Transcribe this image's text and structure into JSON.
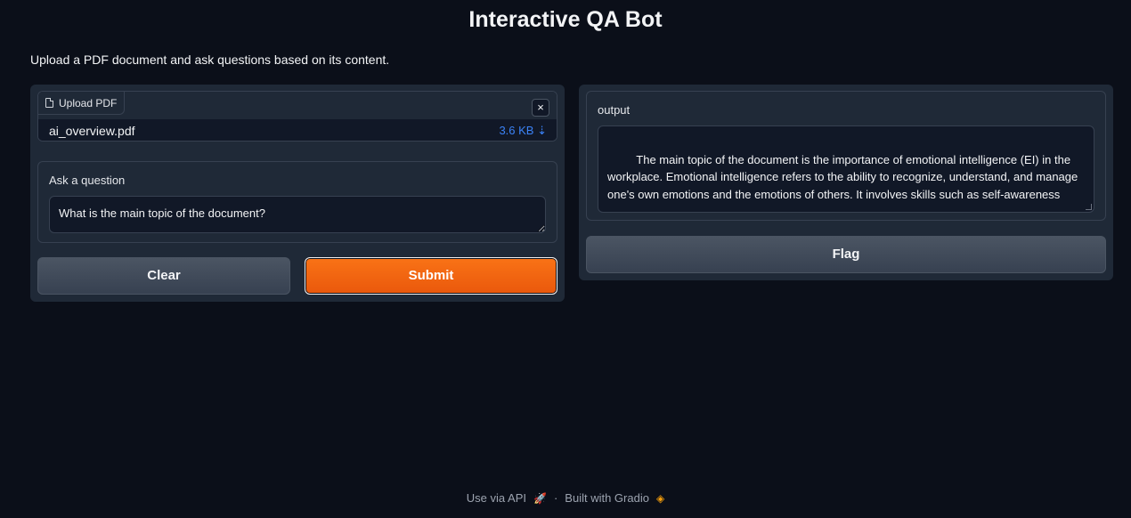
{
  "header": {
    "title": "Interactive QA Bot",
    "description": "Upload a PDF document and ask questions based on its content."
  },
  "upload": {
    "label": "Upload PDF",
    "file_name": "ai_overview.pdf",
    "file_size": "3.6 KB",
    "download_glyph": "⇣",
    "close_glyph": "×"
  },
  "question": {
    "label": "Ask a question",
    "value": "What is the main topic of the document?"
  },
  "buttons": {
    "clear": "Clear",
    "submit": "Submit",
    "flag": "Flag"
  },
  "output": {
    "label": "output",
    "text": " The main topic of the document is the importance of emotional intelligence (EI) in the workplace. Emotional intelligence refers to the ability to recognize, understand, and manage one's own emotions and the emotions of others. It involves skills such as self-awareness"
  },
  "footer": {
    "api_link": "Use via API",
    "separator": "·",
    "built_with": "Built with Gradio"
  },
  "icons": {
    "file": "file-icon",
    "close": "close-icon",
    "download": "download-icon",
    "rocket": "rocket-icon",
    "gradio": "gradio-logo-icon"
  },
  "colors": {
    "accent": "#f97316",
    "background": "#0b0f19",
    "panel": "#1f2937",
    "link": "#3b82f6"
  }
}
